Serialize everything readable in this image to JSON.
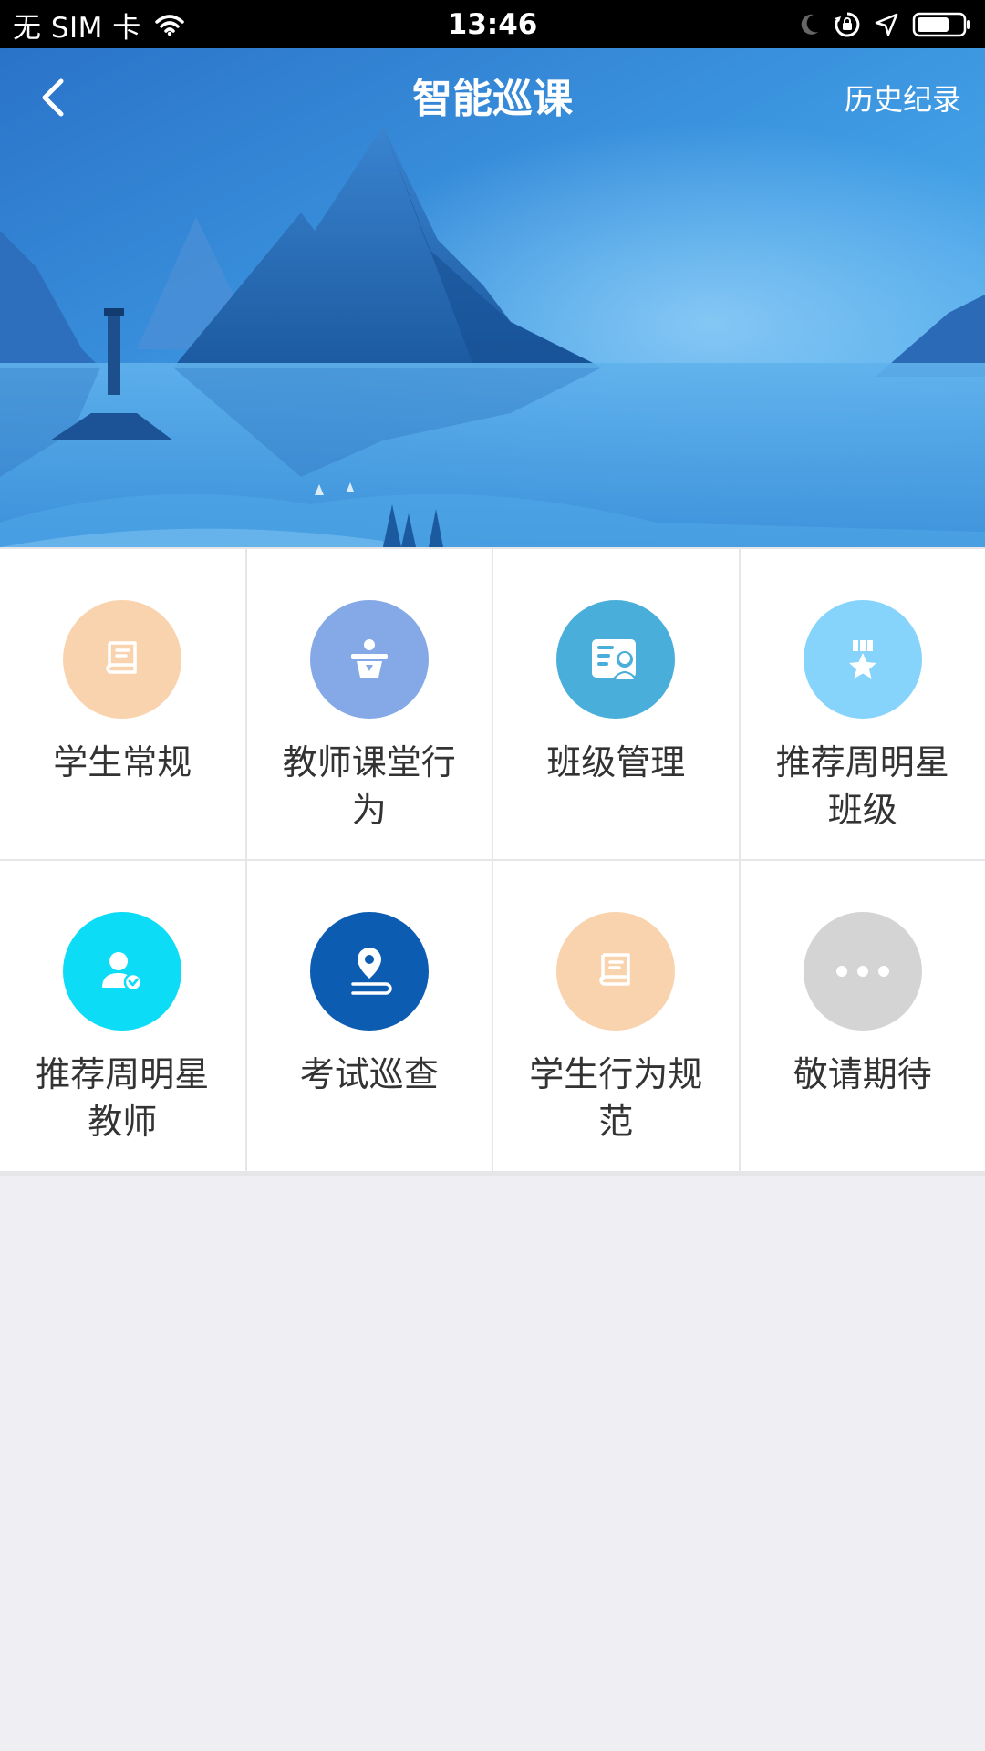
{
  "status_bar": {
    "carrier": "无 SIM 卡",
    "time": "13:46",
    "icons": [
      "wifi-icon",
      "moon-icon",
      "orientation-lock-icon",
      "location-arrow-icon",
      "battery-icon"
    ]
  },
  "header": {
    "title": "智能巡课",
    "back_icon": "chevron-left-icon",
    "history_label": "历史纪录"
  },
  "hero": {
    "background": "mountain-lake-illustration",
    "colors": {
      "sky": "#3a92dc",
      "mountain": "#1f5fa6",
      "water": "#5ab0ea"
    }
  },
  "grid": {
    "items": [
      {
        "label": "学生常规",
        "icon": "book-icon",
        "color": "#f9d3ad"
      },
      {
        "label": "教师课堂行为",
        "icon": "podium-icon",
        "color": "#85a9e6"
      },
      {
        "label": "班级管理",
        "icon": "class-id-icon",
        "color": "#4aaedb"
      },
      {
        "label": "推荐周明星班级",
        "icon": "medal-icon",
        "color": "#86d4fb"
      },
      {
        "label": "推荐周明星教师",
        "icon": "teacher-check-icon",
        "color": "#0cdcf6"
      },
      {
        "label": "考试巡查",
        "icon": "location-pin-icon",
        "color": "#0c5cb2"
      },
      {
        "label": "学生行为规范",
        "icon": "book-icon",
        "color": "#f9d3ad"
      },
      {
        "label": "敬请期待",
        "icon": "more-dots-icon",
        "color": "#d4d4d4"
      }
    ]
  }
}
